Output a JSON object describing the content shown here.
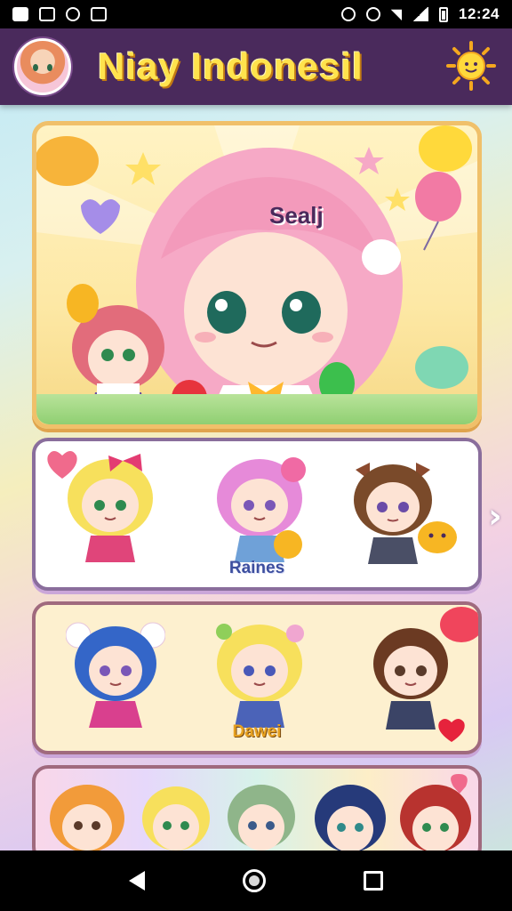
{
  "status_bar": {
    "time": "12:24",
    "left_icons": [
      "gallery-icon",
      "clipboard-icon",
      "camera-icon",
      "video-icon"
    ],
    "right_icons": [
      "alarm-icon",
      "vibrate-icon",
      "wifi-icon",
      "signal-icon",
      "battery-icon"
    ]
  },
  "header": {
    "title": "Niay Indonesil",
    "title_color": "#ffe34d",
    "background": "#4a2a5c"
  },
  "banner": {
    "tag_text": "Sealj"
  },
  "cards": [
    {
      "label": "Raines",
      "characters": [
        "blonde-bow-girl",
        "pink-hair-girl",
        "brown-cat-ear-boy"
      ]
    },
    {
      "label": "Dawei",
      "characters": [
        "blue-hair-girl",
        "blonde-flower-girl",
        "brown-hair-boy"
      ]
    },
    {
      "label": "",
      "characters": [
        "orange-hair-girl",
        "blonde-boy",
        "green-hair-boy",
        "navy-hair-girl",
        "red-hair-girl"
      ]
    }
  ],
  "nav_bar": {
    "buttons": [
      "back-button",
      "home-button",
      "recents-button"
    ]
  }
}
